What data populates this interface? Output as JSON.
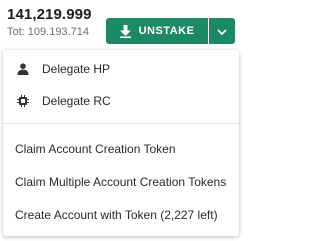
{
  "wallet": {
    "balance": "141,219.999",
    "total": "Tot: 109.193.714"
  },
  "actions": {
    "unstake_label": "UNSTAKE",
    "unstake_icon": "download-arrow-icon",
    "dropdown_icon": "chevron-down-icon",
    "accent_color": "#1b8a63"
  },
  "menu": {
    "items": [
      {
        "label": "Delegate HP",
        "icon": "delegate-user-icon"
      },
      {
        "label": "Delegate RC",
        "icon": "chip-icon"
      },
      {
        "label": "Claim Account Creation Token"
      },
      {
        "label": "Claim Multiple Account Creation Tokens"
      },
      {
        "label": "Create Account with Token (2,227 left)"
      }
    ]
  }
}
